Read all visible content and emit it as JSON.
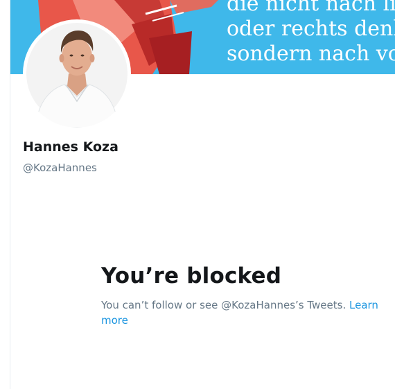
{
  "profile": {
    "banner_lines": [
      "die nicht nach li",
      "oder rechts denk",
      "sondern nach vo"
    ],
    "display_name": "Hannes Koza",
    "handle": "@KozaHannes"
  },
  "blocked": {
    "title": "You’re blocked",
    "message": "You can’t follow or see @KozaHannes’s Tweets.",
    "learn_more": "Learn more"
  },
  "colors": {
    "banner": "#3fb8ea",
    "link": "#1b95e0",
    "text_primary": "#14171a",
    "text_secondary": "#657786"
  }
}
